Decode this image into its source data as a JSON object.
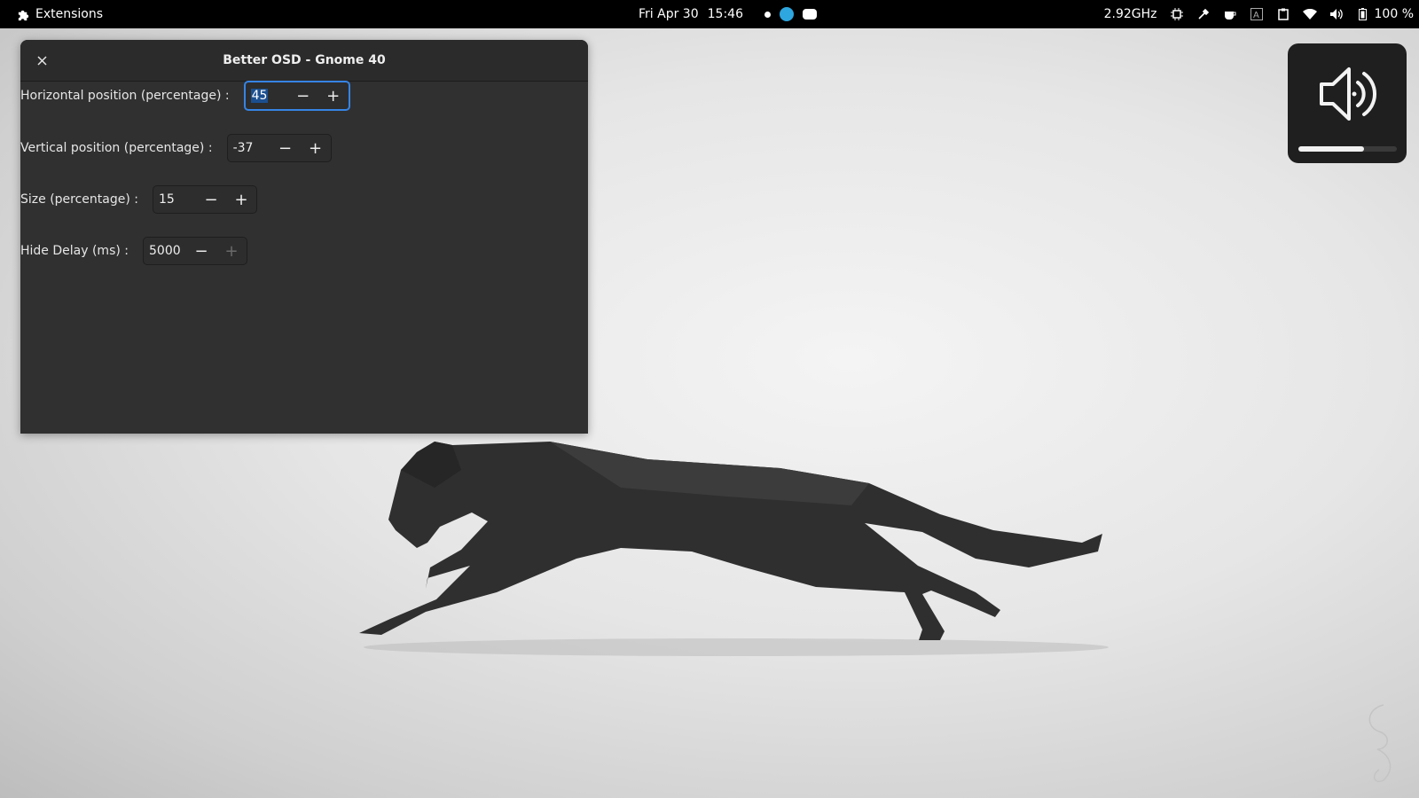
{
  "topbar": {
    "app_label": "Extensions",
    "date": "Fri Apr 30",
    "time": "15:46",
    "cpu_freq": "2.92GHz",
    "battery": "100 %"
  },
  "dialog": {
    "title": "Better OSD - Gnome 40",
    "rows": [
      {
        "label": "Horizontal position (percentage) :",
        "value": "45"
      },
      {
        "label": "Vertical position (percentage) :",
        "value": "-37"
      },
      {
        "label": "Size (percentage) :",
        "value": "15"
      },
      {
        "label": "Hide Delay (ms) :",
        "value": "5000"
      }
    ]
  },
  "osd": {
    "icon": "volume-high-icon",
    "level": 0.67
  },
  "colors": {
    "accent": "#3584e4",
    "selection": "#1b4f8f",
    "dialog_bg": "#303030"
  }
}
